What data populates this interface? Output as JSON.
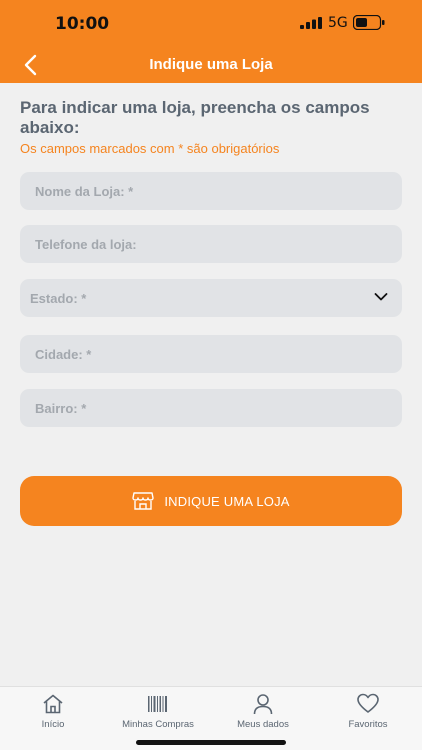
{
  "status_bar": {
    "time": "10:00",
    "network": "5G"
  },
  "header": {
    "title": "Indique uma Loja"
  },
  "form": {
    "heading": "Para indicar uma loja, preencha os campos abaixo:",
    "required_note": "Os campos marcados com * são obrigatórios",
    "fields": {
      "store_name": "Nome da Loja: *",
      "store_phone": "Telefone da loja:",
      "state": "Estado: *",
      "city": "Cidade: *",
      "neighborhood": "Bairro: *"
    },
    "submit_label": "INDIQUE UMA LOJA"
  },
  "tabs": [
    {
      "label": "Início",
      "icon": "home-icon"
    },
    {
      "label": "Minhas Compras",
      "icon": "barcode-icon"
    },
    {
      "label": "Meus dados",
      "icon": "user-icon"
    },
    {
      "label": "Favoritos",
      "icon": "heart-icon"
    }
  ],
  "colors": {
    "accent": "#f5841f",
    "text_dark": "#5b6672",
    "field_bg": "#e1e3e6"
  }
}
